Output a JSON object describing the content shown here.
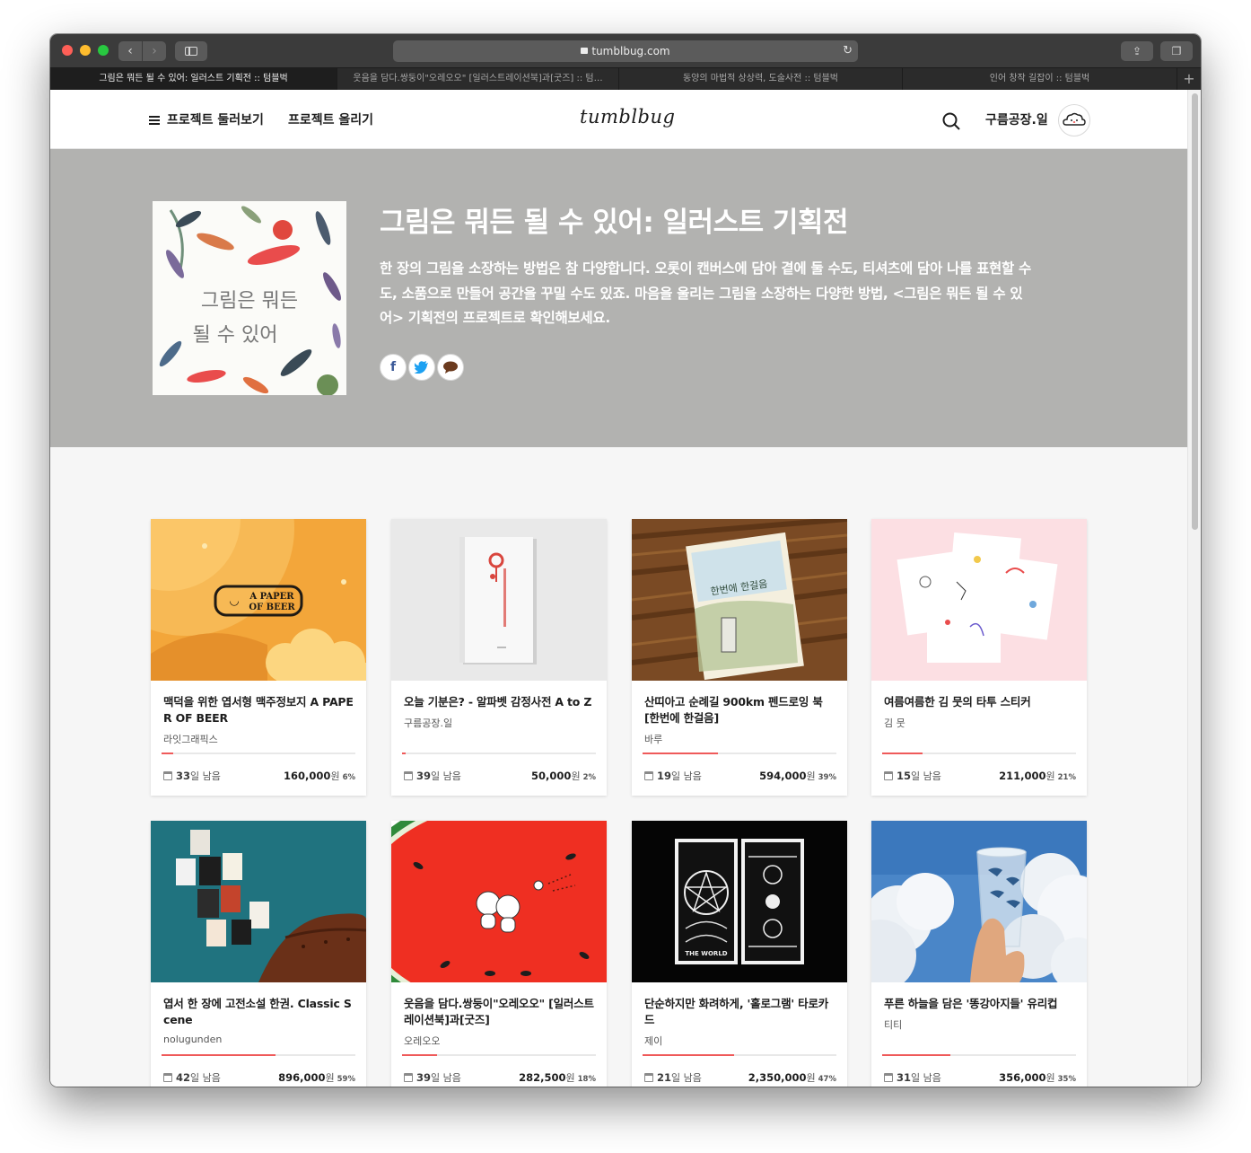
{
  "browser": {
    "url": "tumblbug.com",
    "tabs": [
      {
        "label": "그림은 뭐든 될 수 있어: 일러스트 기획전 :: 텀블벅",
        "active": true
      },
      {
        "label": "웃음을 담다.쌍둥이\"오레오오\" [일러스트레이션북]과[굿즈] :: 텀…",
        "active": false
      },
      {
        "label": "동양의 마법적 상상력, 도술사전 :: 텀블벅",
        "active": false
      },
      {
        "label": "인어 창작 길잡이 :: 텀블벅",
        "active": false
      }
    ],
    "add_tab": "+"
  },
  "header": {
    "browse_label": "프로젝트 둘러보기",
    "upload_label": "프로젝트 올리기",
    "logo": "tumblbug",
    "user_name": "구름공장.일"
  },
  "hero": {
    "title": "그림은 뭐든 될 수 있어: 일러스트 기획전",
    "description": "한 장의 그림을 소장하는 방법은 참 다양합니다. 오롯이 캔버스에 담아 곁에 둘 수도, 티셔츠에 담아 나를 표현할 수도, 소품으로 만들어 공간을 꾸밀 수도 있죠. 마음을 울리는 그림을 소장하는 다양한 방법, <그림은 뭐든 될 수 있어> 기획전의 프로젝트로 확인해보세요.",
    "thumb_text_line1": "그림은 뭐든",
    "thumb_text_line2": "될 수 있어",
    "share": [
      "facebook-icon",
      "twitter-icon",
      "comment-icon"
    ]
  },
  "labels": {
    "days_suffix": "일 남음",
    "currency": "원"
  },
  "cards": [
    {
      "title": "맥덕을 위한 엽서형 맥주정보지 A PAPER OF BEER",
      "creator": "라잇그래픽스",
      "days": "33",
      "amount": "160,000",
      "percent": "6%",
      "progress": 0.06
    },
    {
      "title": "오늘 기분은? - 알파벳 감정사전 A to Z",
      "creator": "구름공장.일",
      "days": "39",
      "amount": "50,000",
      "percent": "2%",
      "progress": 0.02
    },
    {
      "title": "산띠아고 순례길 900km 펜드로잉 북 [한번에 한걸음]",
      "creator": "바루",
      "days": "19",
      "amount": "594,000",
      "percent": "39%",
      "progress": 0.39
    },
    {
      "title": "여름여름한 김 뭇의 타투 스티커",
      "creator": "김 뭇",
      "days": "15",
      "amount": "211,000",
      "percent": "21%",
      "progress": 0.21
    },
    {
      "title": "엽서 한 장에 고전소설 한권. Classic Scene",
      "creator": "nolugunden",
      "days": "42",
      "amount": "896,000",
      "percent": "59%",
      "progress": 0.59
    },
    {
      "title": "웃음을 담다.쌍둥이\"오레오오\" [일러스트레이션북]과[굿즈]",
      "creator": "오레오오",
      "days": "39",
      "amount": "282,500",
      "percent": "18%",
      "progress": 0.18
    },
    {
      "title": "단순하지만 화려하게, '홀로그램' 타로카드",
      "creator": "제이",
      "days": "21",
      "amount": "2,350,000",
      "percent": "47%",
      "progress": 0.47
    },
    {
      "title": "푸른 하늘을 담은 '똥강아지들' 유리컵",
      "creator": "티티",
      "days": "31",
      "amount": "356,000",
      "percent": "35%",
      "progress": 0.35
    }
  ],
  "card_images": [
    {
      "icon": "beer-paper-logo",
      "text_line1": "A PAPER",
      "text_line2": "OF BEER"
    },
    {
      "icon": "book-cover-image"
    },
    {
      "icon": "pen-drawing-book-image",
      "text": "한번에 한걸음"
    },
    {
      "icon": "tattoo-sticker-image"
    },
    {
      "icon": "postcards-wall-image"
    },
    {
      "icon": "watermelon-illustration-image"
    },
    {
      "icon": "tarot-cards-image",
      "text": "THE WORLD"
    },
    {
      "icon": "glass-cup-sky-image"
    }
  ],
  "colors": {
    "accent": "#ef5a5a",
    "hero_bg": "#b2b2b0"
  }
}
